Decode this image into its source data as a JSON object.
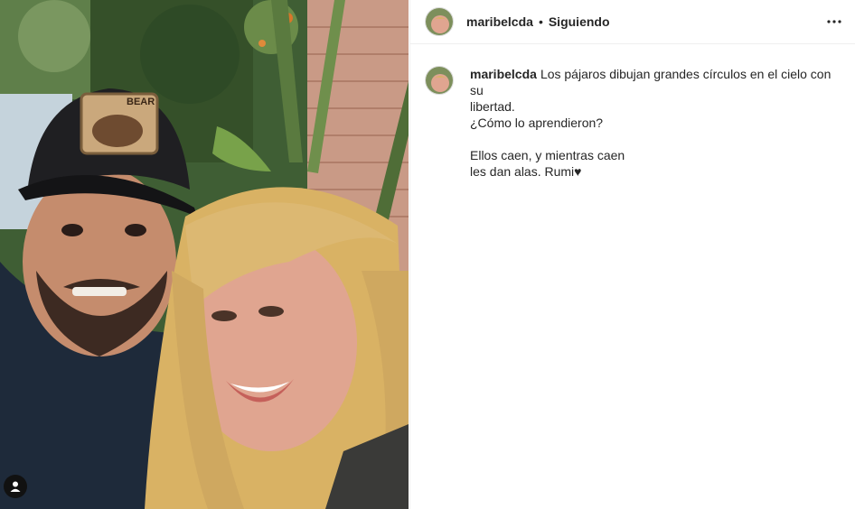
{
  "post": {
    "username": "maribelcda",
    "separator": "•",
    "follow_status": "Siguiendo",
    "more_icon": "more-horizontal-icon",
    "tag_icon": "user-tag-icon",
    "caption": {
      "username": "maribelcda",
      "first_line": "Los pájaros dibujan grandes círculos en el cielo con su",
      "lines": [
        "libertad.",
        "¿Cómo lo aprendieron?"
      ],
      "lines_after_break": [
        "Ellos caen, y mientras caen",
        "les dan alas. Rumi♥"
      ]
    },
    "photo_cap_text": "BEAR"
  }
}
